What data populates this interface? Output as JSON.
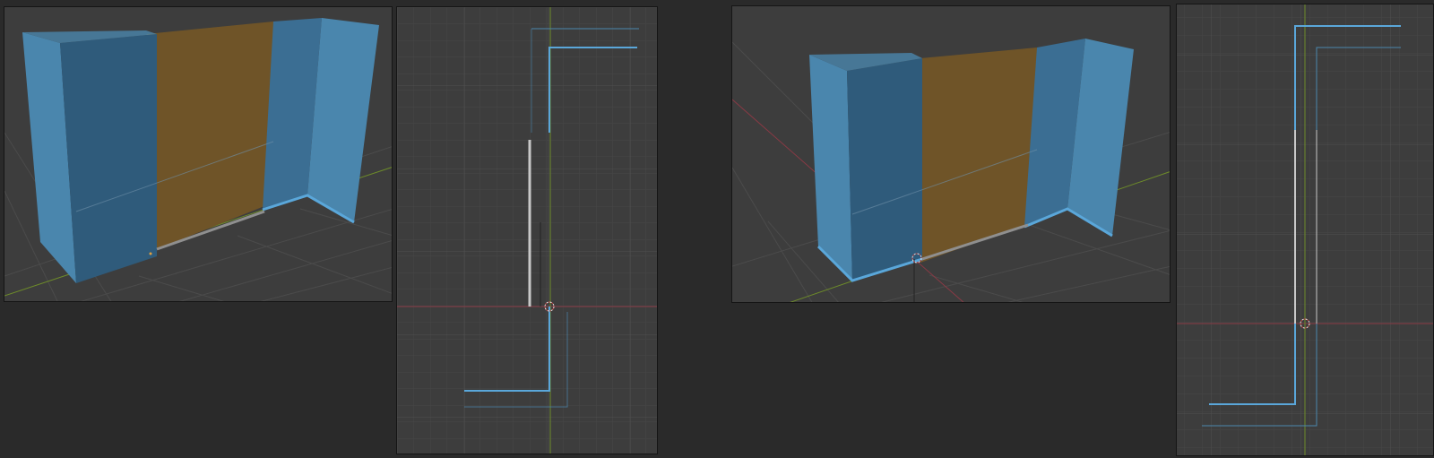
{
  "colors": {
    "background": "#2a2a2a",
    "viewport_bg": "#3d3d3d",
    "grid": "#474747",
    "wall_blue_light": "#4a86ad",
    "wall_blue_dark": "#2f5b7b",
    "wall_orange": "#6f5428",
    "axis_x": "#8a3a45",
    "axis_y": "#6d8b2a",
    "selection_edge": "#4aa0dc"
  },
  "icons": {
    "origin_marker": "origin-crosshair-icon"
  },
  "viewports": [
    {
      "name": "perspective-view",
      "kind": "3d"
    },
    {
      "name": "top-orthographic-view",
      "kind": "2d"
    },
    {
      "name": "perspective-view",
      "kind": "3d"
    },
    {
      "name": "top-orthographic-view",
      "kind": "2d"
    }
  ]
}
